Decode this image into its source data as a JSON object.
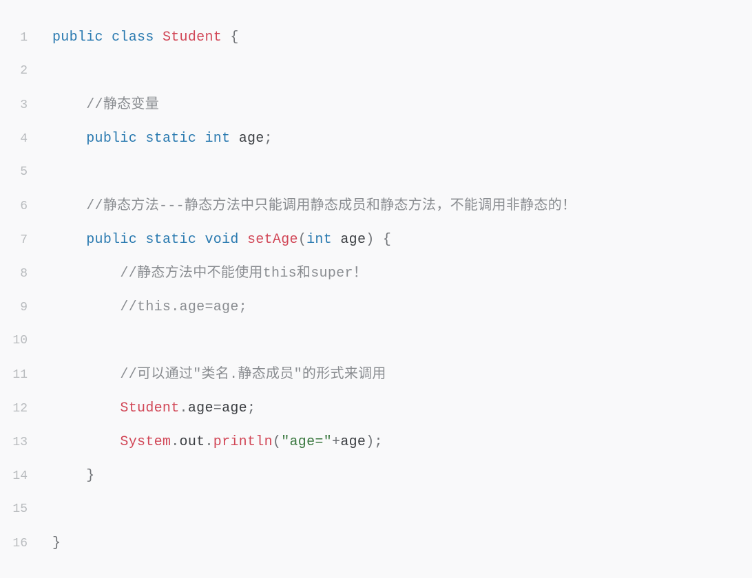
{
  "code": {
    "lines": [
      {
        "num": "1",
        "indent": "",
        "tokens": [
          {
            "cls": "tok-keyword",
            "txt": "public"
          },
          {
            "cls": "tok-plain",
            "txt": " "
          },
          {
            "cls": "tok-keyword",
            "txt": "class"
          },
          {
            "cls": "tok-plain",
            "txt": " "
          },
          {
            "cls": "tok-class",
            "txt": "Student"
          },
          {
            "cls": "tok-plain",
            "txt": " "
          },
          {
            "cls": "tok-punc",
            "txt": "{"
          }
        ]
      },
      {
        "num": "2",
        "indent": "",
        "tokens": []
      },
      {
        "num": "3",
        "indent": "    ",
        "tokens": [
          {
            "cls": "tok-comment",
            "txt": "//静态变量"
          }
        ]
      },
      {
        "num": "4",
        "indent": "    ",
        "tokens": [
          {
            "cls": "tok-keyword",
            "txt": "public"
          },
          {
            "cls": "tok-plain",
            "txt": " "
          },
          {
            "cls": "tok-keyword",
            "txt": "static"
          },
          {
            "cls": "tok-plain",
            "txt": " "
          },
          {
            "cls": "tok-keyword",
            "txt": "int"
          },
          {
            "cls": "tok-plain",
            "txt": " "
          },
          {
            "cls": "tok-field",
            "txt": "age"
          },
          {
            "cls": "tok-punc",
            "txt": ";"
          }
        ]
      },
      {
        "num": "5",
        "indent": "",
        "tokens": []
      },
      {
        "num": "6",
        "indent": "    ",
        "tokens": [
          {
            "cls": "tok-comment",
            "txt": "//静态方法---静态方法中只能调用静态成员和静态方法，不能调用非静态的！"
          }
        ]
      },
      {
        "num": "7",
        "indent": "    ",
        "tokens": [
          {
            "cls": "tok-keyword",
            "txt": "public"
          },
          {
            "cls": "tok-plain",
            "txt": " "
          },
          {
            "cls": "tok-keyword",
            "txt": "static"
          },
          {
            "cls": "tok-plain",
            "txt": " "
          },
          {
            "cls": "tok-keyword",
            "txt": "void"
          },
          {
            "cls": "tok-plain",
            "txt": " "
          },
          {
            "cls": "tok-method",
            "txt": "setAge"
          },
          {
            "cls": "tok-punc",
            "txt": "("
          },
          {
            "cls": "tok-keyword",
            "txt": "int"
          },
          {
            "cls": "tok-plain",
            "txt": " "
          },
          {
            "cls": "tok-field",
            "txt": "age"
          },
          {
            "cls": "tok-punc",
            "txt": ")"
          },
          {
            "cls": "tok-plain",
            "txt": " "
          },
          {
            "cls": "tok-punc",
            "txt": "{"
          }
        ]
      },
      {
        "num": "8",
        "indent": "        ",
        "tokens": [
          {
            "cls": "tok-comment",
            "txt": "//静态方法中不能使用this和super！"
          }
        ]
      },
      {
        "num": "9",
        "indent": "        ",
        "tokens": [
          {
            "cls": "tok-comment",
            "txt": "//this.age=age;"
          }
        ]
      },
      {
        "num": "10",
        "indent": "",
        "tokens": []
      },
      {
        "num": "11",
        "indent": "        ",
        "tokens": [
          {
            "cls": "tok-comment",
            "txt": "//可以通过\"类名.静态成员\"的形式来调用"
          }
        ]
      },
      {
        "num": "12",
        "indent": "        ",
        "tokens": [
          {
            "cls": "tok-class",
            "txt": "Student"
          },
          {
            "cls": "tok-punc",
            "txt": "."
          },
          {
            "cls": "tok-field",
            "txt": "age"
          },
          {
            "cls": "tok-punc",
            "txt": "="
          },
          {
            "cls": "tok-field",
            "txt": "age"
          },
          {
            "cls": "tok-punc",
            "txt": ";"
          }
        ]
      },
      {
        "num": "13",
        "indent": "        ",
        "tokens": [
          {
            "cls": "tok-class",
            "txt": "System"
          },
          {
            "cls": "tok-punc",
            "txt": "."
          },
          {
            "cls": "tok-field",
            "txt": "out"
          },
          {
            "cls": "tok-punc",
            "txt": "."
          },
          {
            "cls": "tok-method",
            "txt": "println"
          },
          {
            "cls": "tok-punc",
            "txt": "("
          },
          {
            "cls": "tok-string",
            "txt": "\"age=\""
          },
          {
            "cls": "tok-punc",
            "txt": "+"
          },
          {
            "cls": "tok-field",
            "txt": "age"
          },
          {
            "cls": "tok-punc",
            "txt": ")"
          },
          {
            "cls": "tok-punc",
            "txt": ";"
          }
        ]
      },
      {
        "num": "14",
        "indent": "    ",
        "tokens": [
          {
            "cls": "tok-punc",
            "txt": "}"
          }
        ]
      },
      {
        "num": "15",
        "indent": "",
        "tokens": []
      },
      {
        "num": "16",
        "indent": "",
        "tokens": [
          {
            "cls": "tok-punc",
            "txt": "}"
          }
        ]
      }
    ]
  }
}
